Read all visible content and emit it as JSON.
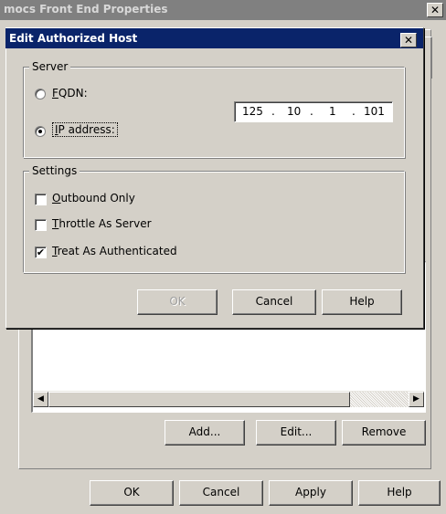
{
  "background_window": {
    "title": "mocs Front End Properties",
    "close_glyph": "✕",
    "edge_char": "\\",
    "scroll_left_glyph": "◀",
    "scroll_right_glyph": "▶",
    "buttons": {
      "add": "Add...",
      "edit": "Edit...",
      "remove": "Remove",
      "ok": "OK",
      "cancel": "Cancel",
      "apply": "Apply",
      "help": "Help"
    }
  },
  "dialog": {
    "title": "Edit Authorized Host",
    "close_glyph": "✕",
    "server": {
      "group_label": "Server",
      "fqdn_label": "FQDN:",
      "ip_label": "IP address:",
      "selected": "ip",
      "ip_octets": [
        "125",
        "10",
        "1",
        "101"
      ],
      "dot": "."
    },
    "settings": {
      "group_label": "Settings",
      "outbound_only": {
        "label": "Outbound Only",
        "checked": false
      },
      "throttle_as_server": {
        "label": "Throttle As Server",
        "checked": false
      },
      "treat_as_authenticated": {
        "label": "Treat As Authenticated",
        "checked": true
      },
      "check_glyph": "✔"
    },
    "buttons": {
      "ok": "OK",
      "cancel": "Cancel",
      "help": "Help"
    }
  }
}
